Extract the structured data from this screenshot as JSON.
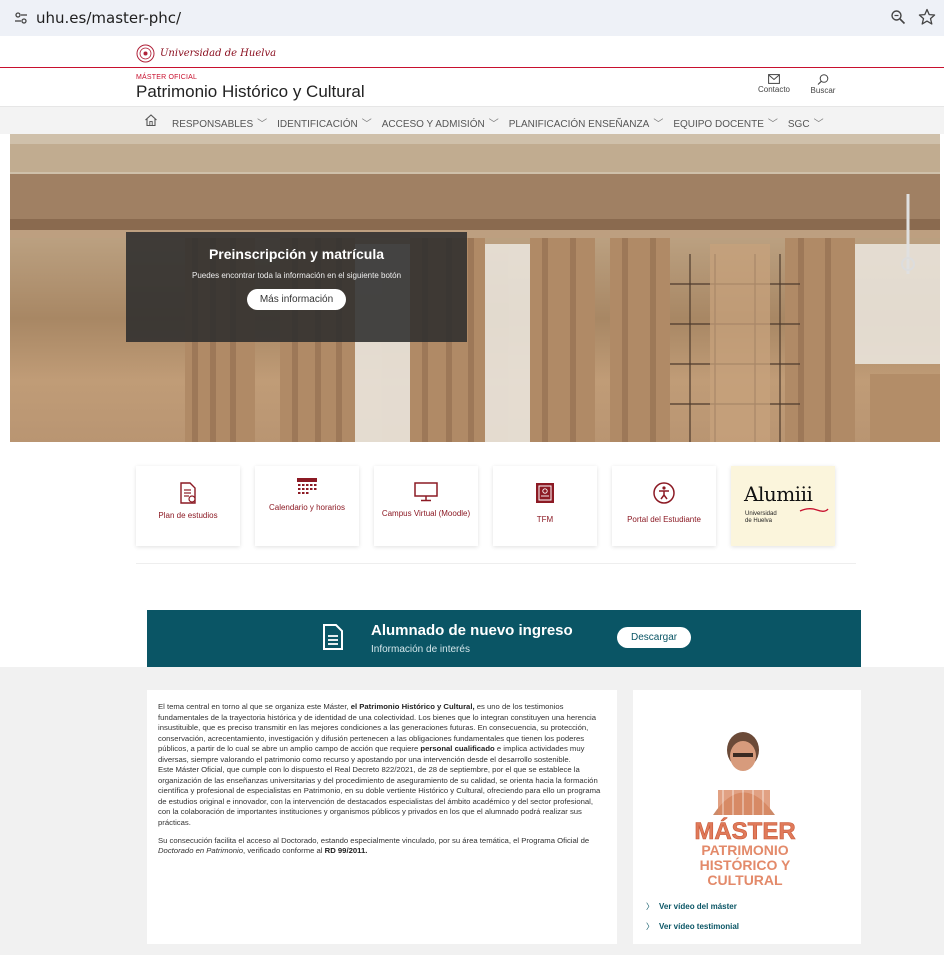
{
  "browser": {
    "url": "uhu.es/master-phc/"
  },
  "university": {
    "name": "Universidad de Huelva"
  },
  "header": {
    "kicker": "MÁSTER OFICIAL",
    "title": "Patrimonio Histórico y Cultural",
    "contact_label": "Contacto",
    "search_label": "Buscar"
  },
  "nav": {
    "items": [
      {
        "label": "RESPONSABLES"
      },
      {
        "label": "IDENTIFICACIÓN"
      },
      {
        "label": "ACCESO Y ADMISIÓN"
      },
      {
        "label": "PLANIFICACIÓN ENSEÑANZA"
      },
      {
        "label": "EQUIPO DOCENTE"
      },
      {
        "label": "SGC"
      }
    ]
  },
  "hero": {
    "title": "Preinscripción y matrícula",
    "text": "Puedes encontrar toda la información en el siguiente botón",
    "button": "Más información"
  },
  "quick_links": {
    "plan": "Plan de estudios",
    "calendar": "Calendario y horarios",
    "campus": "Campus Virtual (Moodle)",
    "tfm": "TFM",
    "portal": "Portal del Estudiante",
    "alumni_logo": "Alumiii",
    "alumni_sub1": "Universidad",
    "alumni_sub2": "de Huelva"
  },
  "banner": {
    "title": "Alumnado de nuevo ingreso",
    "subtitle": "Información de interés",
    "button": "Descargar"
  },
  "intro": {
    "p1_a": "El tema central en torno al que se organiza este Máster, ",
    "p1_b": "el Patrimonio Histórico y Cultural,",
    "p1_c": " es uno de los testimonios fundamentales de la trayectoria histórica y de identidad de una colectividad. Los bienes que lo integran constituyen una herencia insustituible, que es preciso transmitir en las mejores condiciones a las generaciones futuras. En consecuencia, su protección, conservación, acrecentamiento, investigación y difusión pertenecen a las obligaciones fundamentales que tienen los poderes públicos, a partir de lo cual se abre un amplio campo de acción que requiere ",
    "p1_d": "personal cualificado",
    "p1_e": " e implica actividades muy diversas, siempre valorando el patrimonio como recurso y apostando por una intervención desde el desarrollo sostenible.",
    "p2": "Este Máster Oficial, que cumple con lo dispuesto el Real Decreto 822/2021, de 28 de septiembre, por el que se establece la organización de las enseñanzas universitarias y del procedimiento de aseguramiento de su calidad, se orienta hacia la formación científica y profesional de especialistas en Patrimonio, en su doble vertiente Histórico y Cultural, ofreciendo para ello un programa de estudios original e innovador, con la intervención de destacados especialistas del ámbito académico y del sector profesional, con la colaboración de importantes instituciones y organismos públicos y privados en los que el alumnado podrá realizar sus prácticas.",
    "p3_a": "Su consecución facilita el acceso al Doctorado, estando especialmente vinculado, por su área temática, el Programa Oficial de ",
    "p3_b": "Doctorado en Patrimonio",
    "p3_c": ", verificado conforme al ",
    "p3_d": "RD 99/2011."
  },
  "video": {
    "poster_line1": "MÁSTER",
    "poster_line2": "PATRIMONIO",
    "poster_line3": "HISTÓRICO Y",
    "poster_line4": "CULTURAL",
    "link1": "Ver vídeo del máster",
    "link2": "Ver vídeo testimonial"
  }
}
